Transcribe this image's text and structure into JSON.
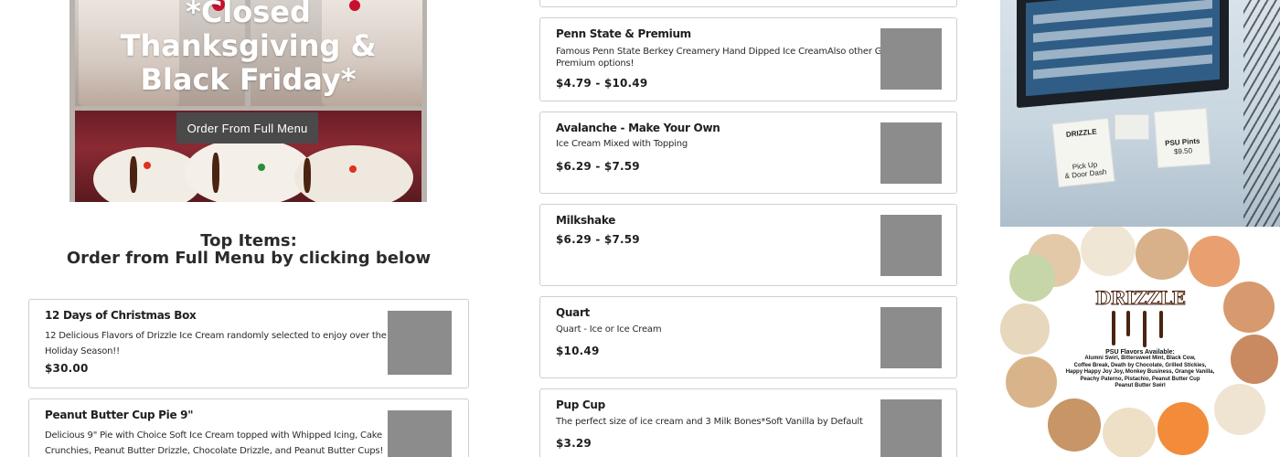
{
  "hero": {
    "title_line1": "*Closed",
    "title_line2": "Thanksgiving &",
    "title_line3": "Black Friday*",
    "button_label": "Order From Full Menu"
  },
  "top_items": {
    "heading_line1": "Top Items:",
    "heading_line2": "Order from Full Menu by clicking below"
  },
  "left_menu": [
    {
      "name": "12 Days of Christmas Box",
      "desc_line1": "12 Delicious Flavors of Drizzle Ice Cream randomly selected to enjoy over the",
      "desc_line2": "Holiday Season!!",
      "price": "$30.00"
    },
    {
      "name": "Peanut Butter Cup Pie 9\"",
      "desc_line1": "Delicious 9\" Pie with Choice Soft Ice Cream topped with Whipped Icing, Cake",
      "desc_line2": "Crunchies, Peanut Butter Drizzle, Chocolate Drizzle, and Peanut Butter Cups!",
      "price": ""
    }
  ],
  "center_menu": [
    {
      "name": "Penn State & Premium",
      "desc_line1": "Famous Penn State Berkey Creamery Hand Dipped Ice CreamAlso other Great",
      "desc_line2": "Premium options!",
      "price": "$4.79 - $10.49"
    },
    {
      "name": "Avalanche - Make Your Own",
      "desc_line1": "Ice Cream Mixed with Topping",
      "desc_line2": "",
      "price": "$6.29 - $7.59"
    },
    {
      "name": "Milkshake",
      "desc_line1": "",
      "desc_line2": "",
      "price": "$6.29 - $7.59"
    },
    {
      "name": "Quart",
      "desc_line1": "Quart - Ice or Ice Cream",
      "desc_line2": "",
      "price": "$10.49"
    },
    {
      "name": "Pup Cup",
      "desc_line1": "The perfect size of ice cream and 3 Milk Bones*Soft Vanilla by Default",
      "desc_line2": "",
      "price": "$3.29"
    }
  ],
  "shop_photo": {
    "sign1_line1": "DRIZZLE",
    "sign1_line2": "Pick Up",
    "sign1_line3": "& Door Dash",
    "sign2_line1": "PSU Pints",
    "sign2_line2": "$9.50"
  },
  "drizzle_photo": {
    "logo": "DRIZZLE",
    "flavors_heading": "PSU Flavors Available:",
    "flavors_line1": "Alumni Swirl, Bittersweet Mint, Black Cow,",
    "flavors_line2": "Coffee Break, Death by Chocolate, Grilled Stickies,",
    "flavors_line3": "Happy Happy Joy Joy, Monkey Business, Orange Vanilla,",
    "flavors_line4": "Peachy Paterno, Pistachio, Peanut Butter Cup",
    "flavors_line5": "Peanut Butter Swirl"
  },
  "colors": {
    "button_bg": "#4a4a4a",
    "card_border": "#cfcfcf",
    "thumb_placeholder": "#8c8c8c",
    "text": "#1f1f1f"
  }
}
